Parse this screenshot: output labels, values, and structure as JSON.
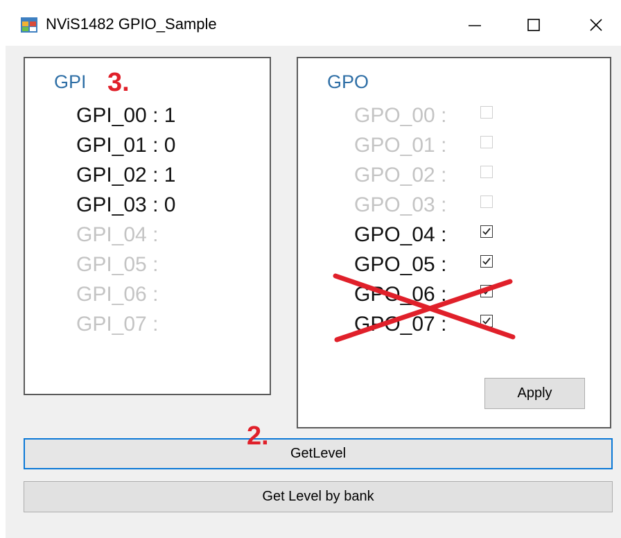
{
  "window": {
    "title": "NViS1482 GPIO_Sample",
    "icon": "app-window-icon",
    "controls": {
      "minimize": "—",
      "maximize": "☐",
      "close": "✕"
    }
  },
  "gpi": {
    "title": "GPI",
    "rows": [
      {
        "label": "GPI_00 :",
        "value": "1",
        "enabled": true
      },
      {
        "label": "GPI_01 :",
        "value": "0",
        "enabled": true
      },
      {
        "label": "GPI_02 :",
        "value": "1",
        "enabled": true
      },
      {
        "label": "GPI_03 :",
        "value": "0",
        "enabled": true
      },
      {
        "label": "GPI_04 :",
        "value": "",
        "enabled": false
      },
      {
        "label": "GPI_05 :",
        "value": "",
        "enabled": false
      },
      {
        "label": "GPI_06 :",
        "value": "",
        "enabled": false
      },
      {
        "label": "GPI_07 :",
        "value": "",
        "enabled": false
      }
    ]
  },
  "gpo": {
    "title": "GPO",
    "rows": [
      {
        "label": "GPO_00 :",
        "checked": false,
        "enabled": false
      },
      {
        "label": "GPO_01 :",
        "checked": false,
        "enabled": false
      },
      {
        "label": "GPO_02 :",
        "checked": false,
        "enabled": false
      },
      {
        "label": "GPO_03 :",
        "checked": false,
        "enabled": false
      },
      {
        "label": "GPO_04 :",
        "checked": true,
        "enabled": true
      },
      {
        "label": "GPO_05 :",
        "checked": true,
        "enabled": true
      },
      {
        "label": "GPO_06 :",
        "checked": true,
        "enabled": true
      },
      {
        "label": "GPO_07 :",
        "checked": true,
        "enabled": true
      }
    ],
    "apply_label": "Apply"
  },
  "buttons": {
    "get_level": "GetLevel",
    "get_level_by_bank": "Get Level by bank"
  },
  "annotations": {
    "step2": "2.",
    "step3": "3.",
    "color": "#e0202a"
  },
  "colors": {
    "group_title": "#2f6fa6",
    "focus_border": "#0a78d7",
    "disabled_text": "#c4c4c4"
  }
}
